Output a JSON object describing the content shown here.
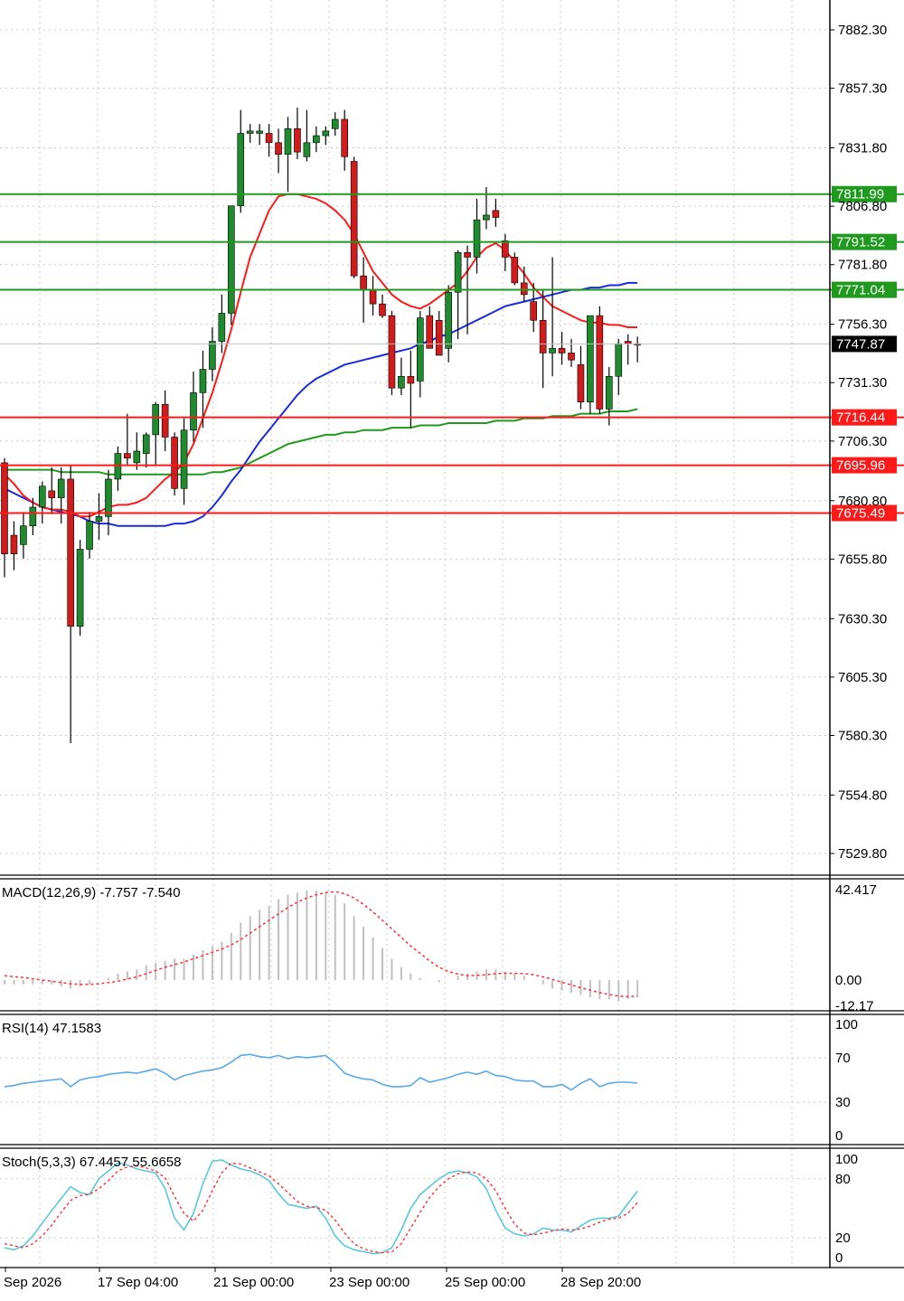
{
  "colors": {
    "up": "#1f8a2e",
    "down": "#d01c1c",
    "wick": "#000000",
    "ma_fast": "#ff1a1a",
    "ma_mid": "#1a2bdc",
    "ma_slow": "#1f9a1f",
    "support": "#ff1a1a",
    "resistance": "#1f9a1f",
    "current_price_bg": "#000000",
    "rsi": "#5aa9e6",
    "stoch_main": "#5ac8d8",
    "stoch_signal": "#ff3030",
    "macd_hist": "#c0c0c0",
    "macd_signal": "#ff3030"
  },
  "chart_data": [
    {
      "type": "candlestick",
      "ylim": [
        7510,
        7910
      ],
      "yticks": [
        "7882.30",
        "7857.30",
        "7831.80",
        "7806.80",
        "7781.80",
        "7756.30",
        "7731.30",
        "7706.30",
        "7680.80",
        "7655.80",
        "7630.30",
        "7605.30",
        "7580.30",
        "7554.80",
        "7529.80"
      ],
      "current_price": "7747.87",
      "current_price_value": 7747.87,
      "resistance_levels": [
        {
          "label": "7811.99",
          "value": 7811.99
        },
        {
          "label": "7791.52",
          "value": 7791.52
        },
        {
          "label": "7771.04",
          "value": 7771.04
        }
      ],
      "support_levels": [
        {
          "label": "7716.44",
          "value": 7716.44
        },
        {
          "label": "7695.96",
          "value": 7695.96
        },
        {
          "label": "7675.49",
          "value": 7675.49
        }
      ],
      "candles": [
        [
          7697,
          7699,
          7648,
          7658
        ],
        [
          7666,
          7672,
          7651,
          7658
        ],
        [
          7662,
          7676,
          7656,
          7670
        ],
        [
          7670,
          7682,
          7666,
          7678
        ],
        [
          7678,
          7689,
          7671,
          7687
        ],
        [
          7685,
          7695,
          7675,
          7682
        ],
        [
          7682,
          7695,
          7671,
          7690
        ],
        [
          7690,
          7696,
          7577,
          7627
        ],
        [
          7627,
          7664,
          7623,
          7660
        ],
        [
          7660,
          7676,
          7656,
          7672
        ],
        [
          7672,
          7684,
          7664,
          7674
        ],
        [
          7674,
          7694,
          7666,
          7690
        ],
        [
          7690,
          7704,
          7685,
          7701
        ],
        [
          7701,
          7718,
          7696,
          7699
        ],
        [
          7697,
          7710,
          7694,
          7702
        ],
        [
          7701,
          7710,
          7695,
          7709
        ],
        [
          7709,
          7723,
          7696,
          7722
        ],
        [
          7722,
          7728,
          7702,
          7708
        ],
        [
          7708,
          7710,
          7683,
          7686
        ],
        [
          7686,
          7716,
          7679,
          7711
        ],
        [
          7711,
          7736,
          7706,
          7727
        ],
        [
          7727,
          7745,
          7712,
          7737
        ],
        [
          7737,
          7755,
          7732,
          7749
        ],
        [
          7749,
          7769,
          7744,
          7761
        ],
        [
          7761,
          7807,
          7756,
          7807
        ],
        [
          7807,
          7848,
          7804,
          7838
        ],
        [
          7838,
          7842,
          7834,
          7839
        ],
        [
          7838,
          7842,
          7833,
          7839
        ],
        [
          7838,
          7842,
          7828,
          7834
        ],
        [
          7834,
          7840,
          7821,
          7829
        ],
        [
          7829,
          7845,
          7813,
          7840
        ],
        [
          7840,
          7849,
          7827,
          7830
        ],
        [
          7828,
          7848,
          7826,
          7834
        ],
        [
          7834,
          7841,
          7830,
          7837
        ],
        [
          7837,
          7841,
          7833,
          7839
        ],
        [
          7840,
          7847,
          7837,
          7844
        ],
        [
          7844,
          7848,
          7822,
          7828
        ],
        [
          7826,
          7828,
          7776,
          7777
        ],
        [
          7777,
          7785,
          7757,
          7771
        ],
        [
          7771,
          7777,
          7760,
          7765
        ],
        [
          7765,
          7769,
          7759,
          7760
        ],
        [
          7760,
          7762,
          7726,
          7729
        ],
        [
          7729,
          7742,
          7726,
          7734
        ],
        [
          7734,
          7745,
          7712,
          7731
        ],
        [
          7732,
          7762,
          7725,
          7759
        ],
        [
          7760,
          7764,
          7746,
          7746
        ],
        [
          7758,
          7762,
          7744,
          7743
        ],
        [
          7746,
          7773,
          7740,
          7770
        ],
        [
          7770,
          7788,
          7750,
          7787
        ],
        [
          7787,
          7790,
          7752,
          7785
        ],
        [
          7785,
          7810,
          7778,
          7801
        ],
        [
          7801,
          7815,
          7797,
          7803
        ],
        [
          7805,
          7810,
          7798,
          7802
        ],
        [
          7792,
          7795,
          7779,
          7785
        ],
        [
          7785,
          7787,
          7773,
          7774
        ],
        [
          7774,
          7781,
          7766,
          7769
        ],
        [
          7766,
          7774,
          7753,
          7758
        ],
        [
          7758,
          7771,
          7729,
          7744
        ],
        [
          7744,
          7785,
          7734,
          7746
        ],
        [
          7746,
          7753,
          7739,
          7744
        ],
        [
          7744,
          7750,
          7738,
          7741
        ],
        [
          7739,
          7747,
          7720,
          7723
        ],
        [
          7723,
          7740,
          7718,
          7760
        ],
        [
          7760,
          7764,
          7718,
          7720
        ],
        [
          7720,
          7738,
          7713,
          7734
        ],
        [
          7734,
          7750,
          7726,
          7748
        ],
        [
          7749,
          7752,
          7739,
          7748
        ],
        [
          7748,
          7751,
          7740,
          7747.87
        ]
      ],
      "ma20": [
        7692,
        7688,
        7683,
        7680,
        7678,
        7677,
        7677,
        7676,
        7674,
        7674,
        7676,
        7678,
        7679,
        7679,
        7680,
        7682,
        7686,
        7690,
        7693,
        7697,
        7705,
        7716,
        7727,
        7740,
        7754,
        7770,
        7785,
        7795,
        7805,
        7811,
        7812,
        7812,
        7811,
        7810,
        7808,
        7805,
        7801,
        7795,
        7787,
        7779,
        7774,
        7769,
        7766,
        7764,
        7763,
        7765,
        7768,
        7771,
        7774,
        7779,
        7785,
        7789,
        7791,
        7788,
        7783,
        7778,
        7772,
        7768,
        7764,
        7762,
        7760,
        7758,
        7757,
        7757,
        7756,
        7756,
        7755,
        7755
      ],
      "ma50": [
        7686,
        7684,
        7682,
        7680,
        7678,
        7677,
        7676,
        7675,
        7674,
        7672,
        7671,
        7671,
        7670,
        7670,
        7670,
        7670,
        7670,
        7670,
        7671,
        7671,
        7672,
        7674,
        7678,
        7683,
        7689,
        7694,
        7700,
        7706,
        7711,
        7716,
        7721,
        7726,
        7730,
        7733,
        7735,
        7737,
        7739,
        7740,
        7741,
        7742,
        7743,
        7744,
        7745,
        7746,
        7748,
        7749,
        7751,
        7752,
        7754,
        7756,
        7758,
        7760,
        7762,
        7764,
        7765,
        7766,
        7767,
        7768,
        7769,
        7770,
        7771,
        7771,
        7772,
        7772,
        7773,
        7773,
        7774,
        7774
      ],
      "ma200": [
        7694,
        7694,
        7694,
        7694,
        7694,
        7694,
        7693,
        7693,
        7693,
        7693,
        7693,
        7692,
        7692,
        7692,
        7692,
        7692,
        7692,
        7692,
        7692,
        7692,
        7692,
        7692,
        7693,
        7693,
        7694,
        7695,
        7697,
        7699,
        7701,
        7703,
        7705,
        7706,
        7707,
        7708,
        7709,
        7709,
        7710,
        7710,
        7711,
        7711,
        7711,
        7712,
        7712,
        7712,
        7713,
        7713,
        7713,
        7714,
        7714,
        7714,
        7714,
        7714,
        7715,
        7715,
        7715,
        7716,
        7716,
        7716,
        7717,
        7717,
        7717,
        7718,
        7718,
        7718,
        7719,
        7719,
        7719,
        7720
      ]
    },
    {
      "type": "bar",
      "label": "MACD(12,26,9) -7.757 -7.540",
      "ylim": [
        -15,
        45
      ],
      "yticks": [
        "42.417",
        "0.00",
        "-12.17"
      ],
      "values": [
        -2,
        -2,
        -2,
        -2,
        -2,
        -2,
        -3,
        -4,
        -3,
        -2,
        0,
        1,
        3,
        4,
        5,
        7,
        8,
        9,
        10,
        10,
        12,
        14,
        16,
        18,
        22,
        27,
        30,
        33,
        35,
        38,
        40,
        41,
        42,
        42,
        41,
        40,
        36,
        30,
        25,
        20,
        15,
        10,
        6,
        3,
        1,
        0,
        -1,
        0,
        2,
        3,
        4,
        5,
        5,
        4,
        3,
        2,
        0,
        -2,
        -4,
        -5,
        -6,
        -7,
        -8,
        -9,
        -9,
        -10,
        -9,
        -8
      ],
      "signal": [
        2,
        1.6,
        1.2,
        0.6,
        0,
        -0.6,
        -1.2,
        -1.8,
        -2,
        -2,
        -1.8,
        -1.2,
        -0.6,
        0.5,
        1.5,
        3,
        4.5,
        6,
        7.2,
        8.4,
        10,
        11.5,
        13,
        14.5,
        16.5,
        19,
        22,
        25,
        28,
        31,
        34,
        36.5,
        38.5,
        40,
        41,
        41.5,
        40.5,
        38.5,
        35.5,
        32,
        28,
        24,
        20,
        16,
        12.5,
        9,
        6,
        4,
        2.8,
        2,
        2.2,
        2.5,
        3,
        3.2,
        3.2,
        3,
        2.5,
        1.5,
        0.3,
        -1,
        -2.3,
        -3.6,
        -4.8,
        -5.9,
        -6.8,
        -7.5,
        -7.8,
        -7.5
      ]
    },
    {
      "type": "line",
      "label": "RSI(14) 47.1583",
      "ylim": [
        0,
        100
      ],
      "yticks": [
        "100",
        "70",
        "30",
        "0"
      ],
      "values": [
        44,
        45,
        47,
        48,
        49,
        50,
        51,
        44,
        50,
        52,
        53,
        55,
        56,
        57,
        56,
        58,
        60,
        56,
        50,
        54,
        56,
        58,
        59,
        61,
        66,
        72,
        73,
        71,
        70,
        72,
        69,
        71,
        70,
        71,
        72,
        65,
        56,
        53,
        51,
        50,
        46,
        44,
        44,
        45,
        52,
        48,
        50,
        52,
        55,
        57,
        55,
        58,
        54,
        53,
        50,
        49,
        49,
        44,
        44,
        46,
        41,
        47,
        51,
        44,
        47,
        48,
        48,
        47.1583
      ]
    },
    {
      "type": "line",
      "label": "Stoch(5,3,3) 67.4457 55.6658",
      "ylim": [
        0,
        100
      ],
      "yticks": [
        "100",
        "80",
        "20",
        "0"
      ],
      "main": [
        10,
        8,
        12,
        22,
        35,
        48,
        60,
        72,
        66,
        64,
        80,
        88,
        96,
        94,
        90,
        88,
        86,
        70,
        40,
        28,
        45,
        75,
        98,
        99,
        94,
        90,
        88,
        84,
        78,
        65,
        54,
        52,
        50,
        52,
        40,
        22,
        12,
        8,
        6,
        4,
        5,
        10,
        28,
        50,
        64,
        72,
        80,
        86,
        88,
        86,
        82,
        70,
        48,
        30,
        24,
        22,
        24,
        30,
        28,
        28,
        26,
        32,
        38,
        40,
        40,
        42,
        55,
        67.4457
      ],
      "signal": [
        14,
        12,
        10,
        14,
        22,
        33,
        46,
        58,
        63,
        64,
        70,
        78,
        88,
        92,
        93,
        91,
        88,
        81,
        62,
        45,
        37,
        48,
        68,
        86,
        96,
        95,
        91,
        87,
        83,
        75,
        66,
        57,
        52,
        51,
        48,
        38,
        25,
        14,
        9,
        6,
        5,
        6,
        14,
        30,
        46,
        61,
        72,
        80,
        85,
        87,
        86,
        80,
        68,
        50,
        34,
        25,
        23,
        25,
        27,
        29,
        28,
        29,
        32,
        36,
        39,
        40,
        45,
        55.6658
      ]
    }
  ],
  "time_axis": {
    "labels": [
      "Sep 2026",
      "17 Sep 04:00",
      "21 Sep 00:00",
      "23 Sep 00:00",
      "25 Sep 00:00",
      "28 Sep 20:00"
    ]
  }
}
